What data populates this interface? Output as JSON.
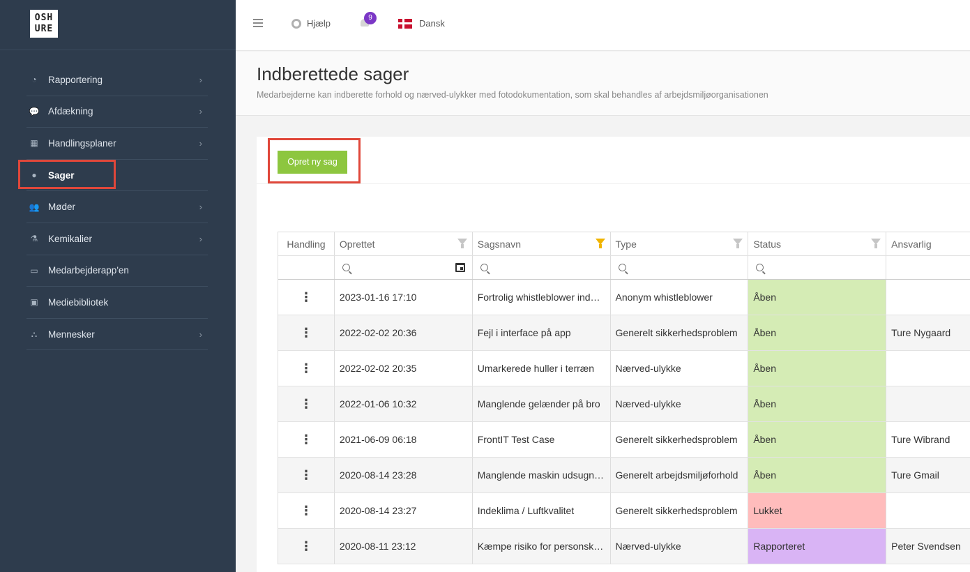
{
  "logo": {
    "line1": "OSH",
    "line2": "URE"
  },
  "sidebar": {
    "items": [
      {
        "label": "Rapportering",
        "icon": "pie-chart-icon",
        "glyph": "◔",
        "has_chevron": true
      },
      {
        "label": "Afdækning",
        "icon": "chat-bubbles-icon",
        "glyph": "💬",
        "has_chevron": true
      },
      {
        "label": "Handlingsplaner",
        "icon": "calendar-icon",
        "glyph": "▦",
        "has_chevron": true
      },
      {
        "label": "Sager",
        "icon": "alert-circle-icon",
        "glyph": "●",
        "has_chevron": false
      },
      {
        "label": "Møder",
        "icon": "users-icon",
        "glyph": "👥",
        "has_chevron": true
      },
      {
        "label": "Kemikalier",
        "icon": "flask-icon",
        "glyph": "⚗",
        "has_chevron": true
      },
      {
        "label": "Medarbejderapp'en",
        "icon": "devices-icon",
        "glyph": "▭",
        "has_chevron": false
      },
      {
        "label": "Mediebibliotek",
        "icon": "image-icon",
        "glyph": "▣",
        "has_chevron": false
      },
      {
        "label": "Mennesker",
        "icon": "org-chart-icon",
        "glyph": "⛬",
        "has_chevron": true
      }
    ],
    "active": "Sager"
  },
  "topbar": {
    "help_label": "Hjælp",
    "notification_count": "9",
    "language_label": "Dansk"
  },
  "page": {
    "title": "Indberettede sager",
    "subtitle": "Medarbejderne kan indberette forhold og nærved-ulykker med fotodokumentation, som skal behandles af arbejdsmiljøorganisationen"
  },
  "toolbar": {
    "new_case_label": "Opret ny sag"
  },
  "table": {
    "columns": [
      "Handling",
      "Oprettet",
      "Sagsnavn",
      "Type",
      "Status",
      "Ansvarlig"
    ],
    "rows": [
      {
        "created": "2023-01-16 17:10",
        "name": "Fortrolig whistleblower ind…",
        "type": "Anonym whistleblower",
        "status": "Åben",
        "responsible": ""
      },
      {
        "created": "2022-02-02 20:36",
        "name": "Fejl i interface på app",
        "type": "Generelt sikkerhedsproblem",
        "status": "Åben",
        "responsible": "Ture Nygaard"
      },
      {
        "created": "2022-02-02 20:35",
        "name": "Umarkerede huller i terræn",
        "type": "Nærved-ulykke",
        "status": "Åben",
        "responsible": ""
      },
      {
        "created": "2022-01-06 10:32",
        "name": "Manglende gelænder på bro",
        "type": "Nærved-ulykke",
        "status": "Åben",
        "responsible": ""
      },
      {
        "created": "2021-06-09 06:18",
        "name": "FrontIT Test Case",
        "type": "Generelt sikkerhedsproblem",
        "status": "Åben",
        "responsible": "Ture Wibrand"
      },
      {
        "created": "2020-08-14 23:28",
        "name": "Manglende maskin udsugn…",
        "type": "Generelt arbejdsmiljøforhold",
        "status": "Åben",
        "responsible": "Ture Gmail"
      },
      {
        "created": "2020-08-14 23:27",
        "name": "Indeklima / Luftkvalitet",
        "type": "Generelt sikkerhedsproblem",
        "status": "Lukket",
        "responsible": ""
      },
      {
        "created": "2020-08-11 23:12",
        "name": "Kæmpe risiko for personsk…",
        "type": "Nærved-ulykke",
        "status": "Rapporteret",
        "responsible": "Peter Svendsen"
      }
    ]
  },
  "colors": {
    "sidebar_bg": "#2e3c4d",
    "accent_green": "#8dc63f",
    "highlight_red": "#e0473a",
    "status_open": "#d5ecb5",
    "status_closed": "#ffbcbc",
    "status_reported": "#d9b4f5",
    "badge_purple": "#7b37c6"
  }
}
